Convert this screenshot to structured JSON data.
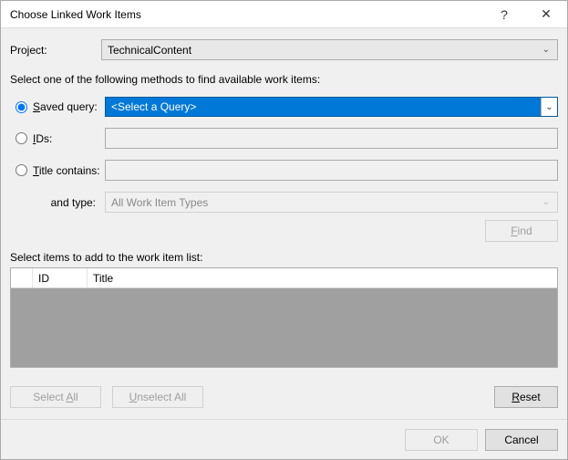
{
  "window": {
    "title": "Choose Linked Work Items",
    "help_label": "?",
    "close_label": "✕"
  },
  "project": {
    "label": "Project:",
    "value": "TechnicalContent"
  },
  "instruction": "Select one of the following methods to find available work items:",
  "methods": {
    "saved_query": {
      "label_pre": "",
      "label_key": "S",
      "label_post": "aved query:"
    },
    "ids": {
      "label_pre": "",
      "label_key": "I",
      "label_post": "Ds:"
    },
    "title": {
      "label_pre": "",
      "label_key": "T",
      "label_post": "itle contains:"
    },
    "selected": "saved_query"
  },
  "query_select": {
    "placeholder": "<Select a Query>"
  },
  "and_type": {
    "label": "and type:",
    "value": "All Work Item Types"
  },
  "find": {
    "label_pre": "",
    "label_key": "F",
    "label_post": "ind"
  },
  "grid": {
    "label": "Select items to add to the work item list:",
    "columns": {
      "id": "ID",
      "title": "Title"
    },
    "rows": []
  },
  "buttons": {
    "select_all": {
      "pre": "Select ",
      "key": "A",
      "post": "ll"
    },
    "unselect_all": {
      "pre": "",
      "key": "U",
      "post": "nselect All"
    },
    "reset": {
      "pre": "",
      "key": "R",
      "post": "eset"
    },
    "ok": "OK",
    "cancel": "Cancel"
  }
}
